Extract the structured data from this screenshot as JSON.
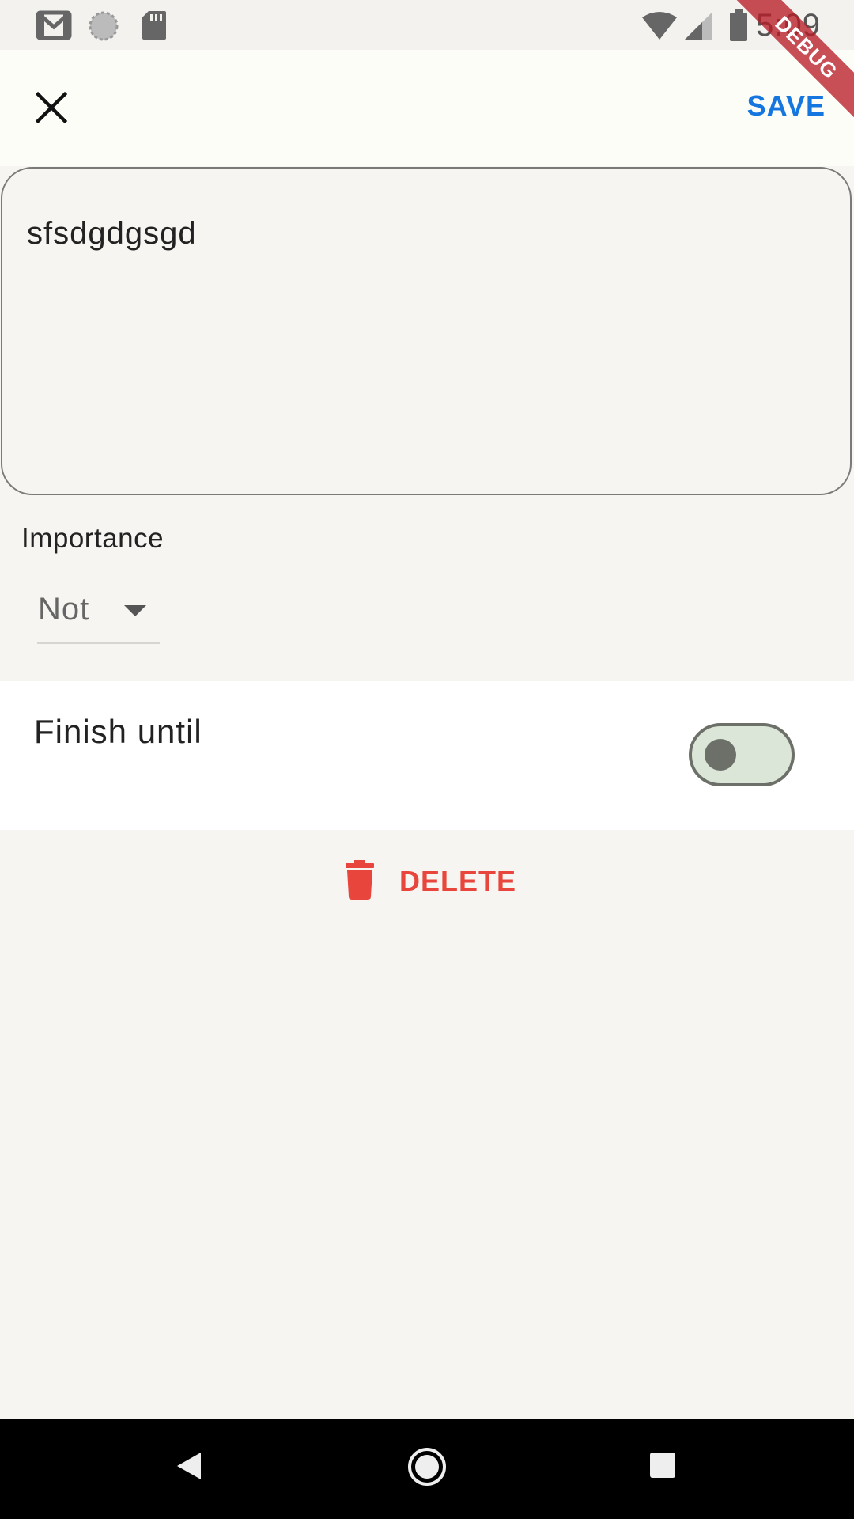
{
  "status_bar": {
    "time": "5:09",
    "left_icons": [
      "gmail-icon",
      "sync-circle-icon",
      "sd-card-icon"
    ],
    "right_icons": [
      "wifi-icon",
      "cellular-signal-icon",
      "battery-icon"
    ]
  },
  "debug_banner": "DEBUG",
  "app_bar": {
    "close_icon": "close-icon",
    "save_label": "SAVE"
  },
  "task": {
    "text": "sfsdgdgsgd"
  },
  "importance": {
    "label": "Importance",
    "selected": "Not"
  },
  "finish_until": {
    "label": "Finish until",
    "enabled": false
  },
  "delete": {
    "icon": "trash-icon",
    "label": "DELETE"
  },
  "nav_bar": {
    "buttons": [
      "back-icon",
      "home-icon",
      "recents-icon"
    ]
  },
  "colors": {
    "accent": "#1676e0",
    "danger": "#e8453c",
    "background": "#f6f5f2"
  }
}
